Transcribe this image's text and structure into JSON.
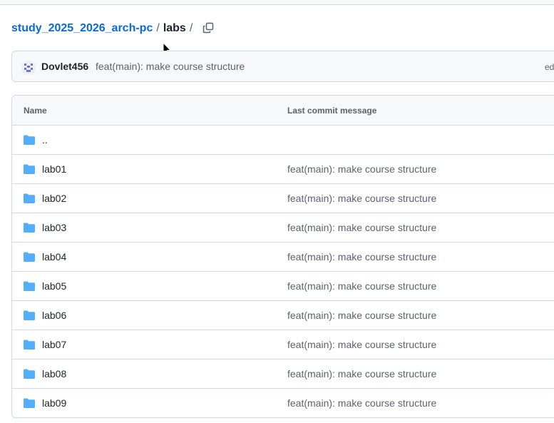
{
  "breadcrumb": {
    "repo": "study_2025_2026_arch-pc",
    "separator": "/",
    "current": "labs",
    "trailing_separator": "/"
  },
  "icons": {
    "copy_path": "copy-icon",
    "folder": "folder-icon",
    "avatar": "avatar-icon"
  },
  "colors": {
    "link": "#0969da",
    "folder": "#54aeff",
    "muted": "#59636e",
    "border": "#d1d9e0",
    "header_bg": "#f6f8fa"
  },
  "commit": {
    "author": "Dovlet456",
    "message": "feat(main): make course structure",
    "extra": "ed"
  },
  "table": {
    "columns": [
      "Name",
      "Last commit message"
    ],
    "rows": [
      {
        "name": "..",
        "message": ""
      },
      {
        "name": "lab01",
        "message": "feat(main): make course structure"
      },
      {
        "name": "lab02",
        "message": "feat(main): make course structure"
      },
      {
        "name": "lab03",
        "message": "feat(main): make course structure"
      },
      {
        "name": "lab04",
        "message": "feat(main): make course structure"
      },
      {
        "name": "lab05",
        "message": "feat(main): make course structure"
      },
      {
        "name": "lab06",
        "message": "feat(main): make course structure"
      },
      {
        "name": "lab07",
        "message": "feat(main): make course structure"
      },
      {
        "name": "lab08",
        "message": "feat(main): make course structure"
      },
      {
        "name": "lab09",
        "message": "feat(main): make course structure"
      }
    ]
  }
}
